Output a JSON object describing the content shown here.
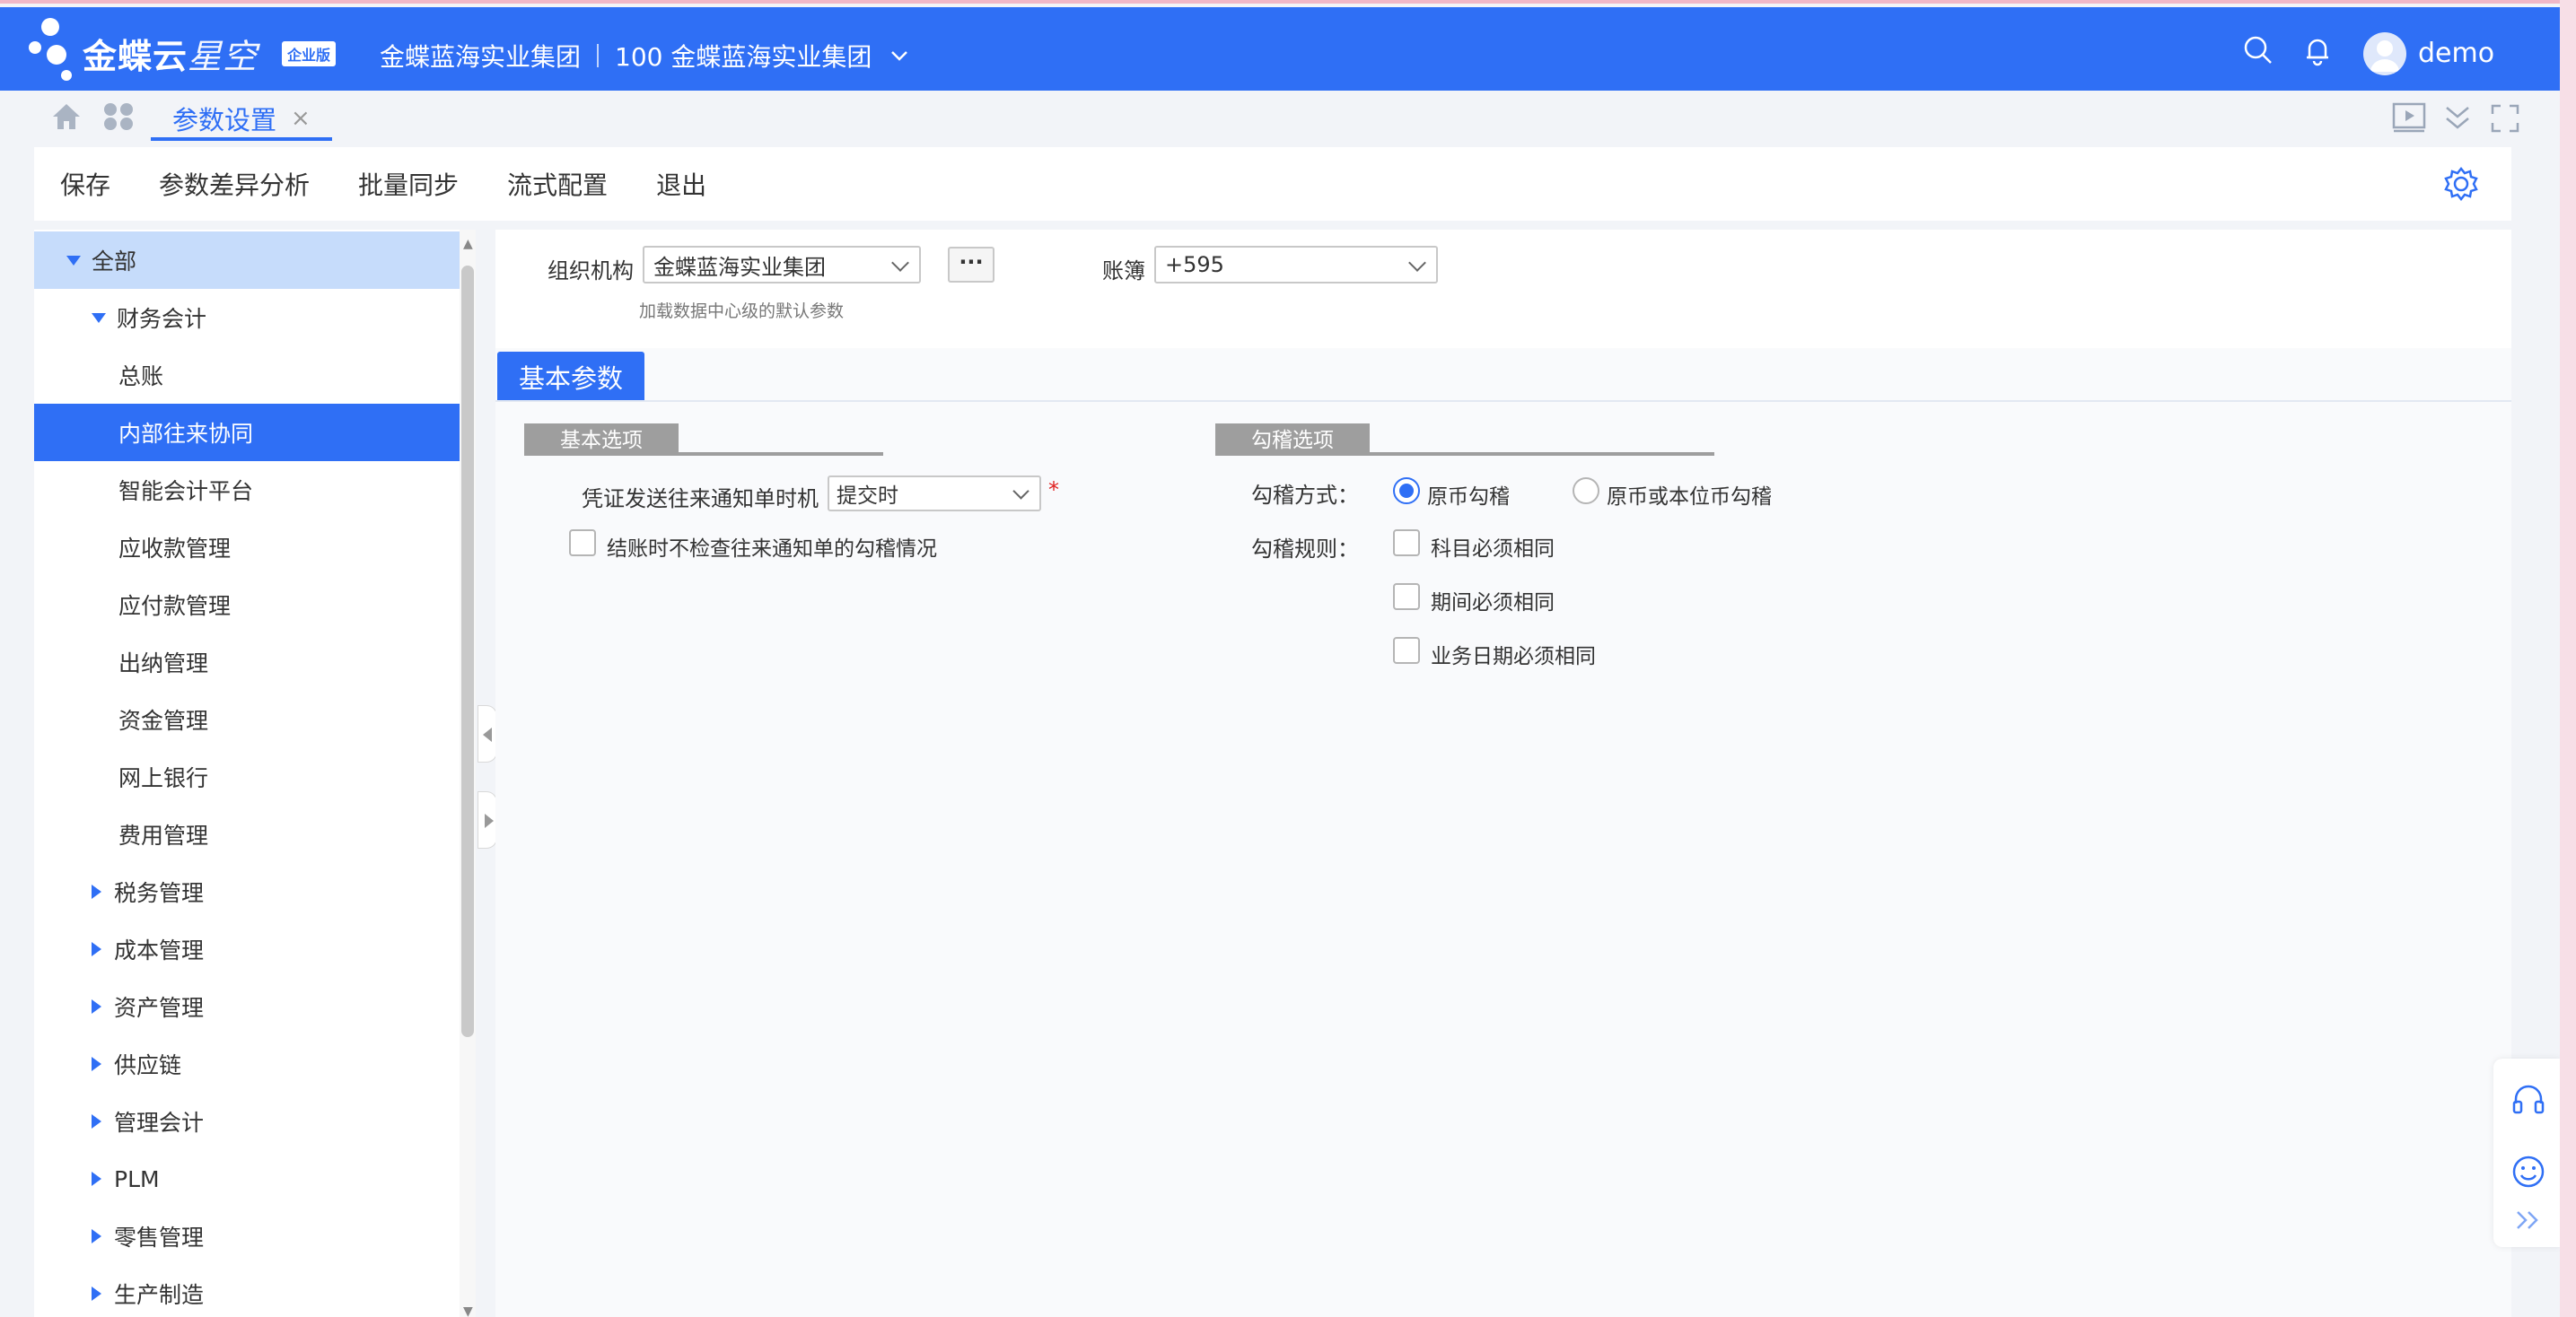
{
  "app": {
    "brand": "金蝶云",
    "brand_star": "星空",
    "edition_badge": "企业版",
    "org_name": "金蝶蓝海实业集团",
    "org_code_name": "100 金蝶蓝海实业集团",
    "user": "demo",
    "accent": "#2f6ff5"
  },
  "tabs": {
    "active_label": "参数设置",
    "close_glyph": "×"
  },
  "toolbar": {
    "save": "保存",
    "diff_analysis": "参数差异分析",
    "batch_sync": "批量同步",
    "flow_config": "流式配置",
    "exit": "退出"
  },
  "sidebar": {
    "items": [
      {
        "label": "全部"
      },
      {
        "label": "财务会计"
      },
      {
        "label": "总账"
      },
      {
        "label": "内部往来协同"
      },
      {
        "label": "智能会计平台"
      },
      {
        "label": "应收款管理"
      },
      {
        "label": "应付款管理"
      },
      {
        "label": "出纳管理"
      },
      {
        "label": "资金管理"
      },
      {
        "label": "网上银行"
      },
      {
        "label": "费用管理"
      },
      {
        "label": "税务管理"
      },
      {
        "label": "成本管理"
      },
      {
        "label": "资产管理"
      },
      {
        "label": "供应链"
      },
      {
        "label": "管理会计"
      },
      {
        "label": "PLM"
      },
      {
        "label": "零售管理"
      },
      {
        "label": "生产制造"
      }
    ]
  },
  "filter": {
    "org_label": "组织机构",
    "org_value": "金蝶蓝海实业集团",
    "more_label": "···",
    "hint": "加载数据中心级的默认参数",
    "book_label": "账簿",
    "book_value": "+595"
  },
  "section": {
    "tab_label": "基本参数"
  },
  "basic_options": {
    "group_label": "基本选项",
    "voucher_timing_label": "凭证发送往来通知单时机",
    "voucher_timing_value": "提交时",
    "required_mark": "*",
    "no_check_label": "结账时不检查往来通知单的勾稽情况"
  },
  "match_options": {
    "group_label": "勾稽选项",
    "method_label": "勾稽方式：",
    "method_options": [
      "原币勾稽",
      "原币或本位币勾稽"
    ],
    "method_selected": "原币勾稽",
    "rule_label": "勾稽规则：",
    "rule_options": [
      "科目必须相同",
      "期间必须相同",
      "业务日期必须相同"
    ]
  }
}
